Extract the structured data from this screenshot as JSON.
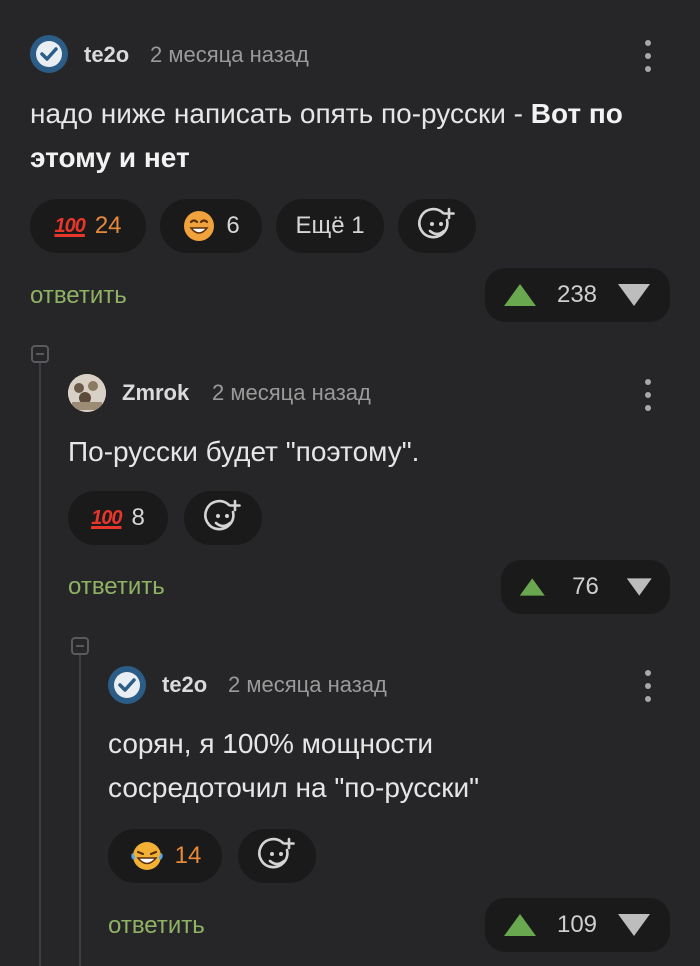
{
  "comments": [
    {
      "username": "te2o",
      "time": "2 месяца назад",
      "text_plain": "надо ниже написать опять по-русски - ",
      "text_bold": "Вот по этому и нет",
      "reactions": [
        {
          "icon": "hundred-points-icon",
          "count": "24"
        },
        {
          "icon": "smiling-face-icon",
          "count": "6"
        }
      ],
      "more_label": "Ещё 1",
      "reply_label": "ответить",
      "score": "238"
    },
    {
      "username": "Zmrok",
      "time": "2 месяца назад",
      "text": "По-русски будет \"поэтому\".",
      "reactions": [
        {
          "icon": "hundred-points-icon",
          "count": "8"
        }
      ],
      "reply_label": "ответить",
      "score": "76"
    },
    {
      "username": "te2o",
      "time": "2 месяца назад",
      "text": "сорян, я 100% мощности сосредоточил на \"по-русски\"",
      "reactions": [
        {
          "icon": "laughing-tears-icon",
          "count": "14"
        }
      ],
      "reply_label": "ответить",
      "score": "109"
    }
  ],
  "colors": {
    "background": "#262628",
    "pill": "#1a1a1b",
    "reply_link": "#8fb264",
    "upvote": "#6aa84f",
    "active_count": "#e8893a"
  },
  "emoji": {
    "hundred": "100"
  }
}
